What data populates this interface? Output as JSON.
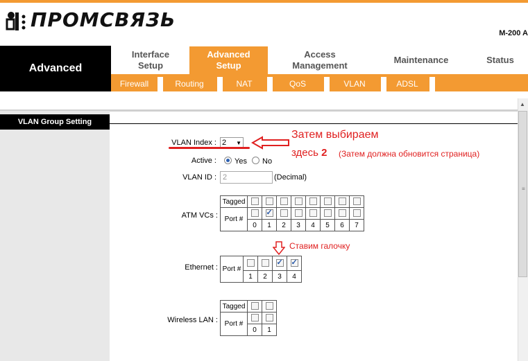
{
  "brand": {
    "logo_text": "ПРОМСВЯЗЬ",
    "model": "M-200 A",
    "accent": "#f39a32"
  },
  "nav": {
    "section": "Advanced",
    "tabs": [
      {
        "label": "Interface Setup",
        "active": false
      },
      {
        "label": "Advanced Setup",
        "active": true
      },
      {
        "label": "Access Management",
        "active": false
      },
      {
        "label": "Maintenance",
        "active": false
      },
      {
        "label": "Status",
        "active": false
      }
    ],
    "subtabs": [
      "Firewall",
      "Routing",
      "NAT",
      "QoS",
      "VLAN",
      "ADSL"
    ]
  },
  "section_title": "VLAN Group Setting",
  "form": {
    "vlan_index_label": "VLAN Index :",
    "vlan_index_value": "2",
    "active_label": "Active :",
    "active_yes": "Yes",
    "active_no": "No",
    "vlan_id_label": "VLAN ID :",
    "vlan_id_value": "2",
    "vlan_id_unit": "(Decimal)",
    "atm_label": "ATM VCs :",
    "ethernet_label": "Ethernet :",
    "wireless_label": "Wireless LAN :",
    "tagged_label": "Tagged",
    "port_label": "Port #",
    "atm_ports": [
      "0",
      "1",
      "2",
      "3",
      "4",
      "5",
      "6",
      "7"
    ],
    "atm_port_checked": [
      false,
      true,
      false,
      false,
      false,
      false,
      false,
      false
    ],
    "eth_ports": [
      "1",
      "2",
      "3",
      "4"
    ],
    "eth_port_checked": [
      false,
      false,
      true,
      true
    ],
    "wlan_ports": [
      "0",
      "1"
    ]
  },
  "annotations": {
    "line1": "Затем выбираем",
    "line2": "здесь 2",
    "line2_note": "(Затем должна обновится страница)",
    "checkmark_note": "Ставим галочку"
  }
}
